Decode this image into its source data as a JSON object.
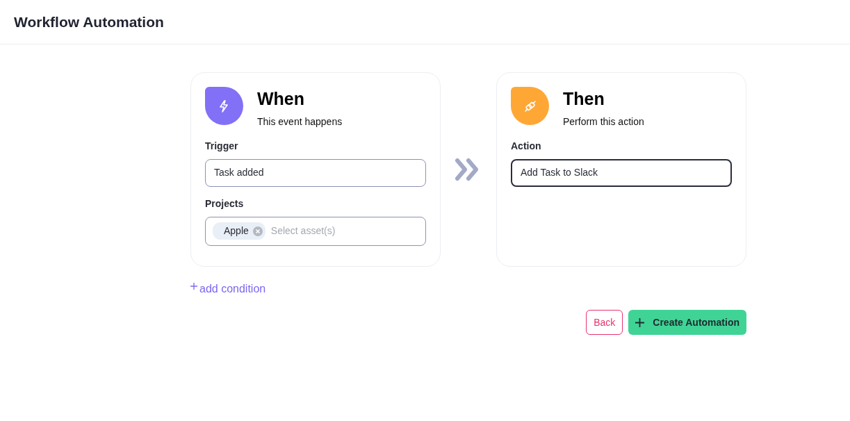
{
  "header": {
    "title": "Workflow Automation"
  },
  "cards": [
    {
      "kind": "trigger",
      "title": "When",
      "subtitle": "This event happens",
      "color": "#8270f6",
      "fields": [
        {
          "kind": "select",
          "label": "Trigger",
          "value": "Task added",
          "focused": false
        },
        {
          "kind": "tags",
          "label": "Projects",
          "tags": [
            "Apple"
          ],
          "placeholder": "Select asset(s)",
          "focused": false
        }
      ]
    },
    {
      "kind": "action",
      "title": "Then",
      "subtitle": "Perform this action",
      "color": "#ffa735",
      "fields": [
        {
          "kind": "select",
          "label": "Action",
          "value": "Add Task to Slack",
          "focused": true
        }
      ]
    }
  ],
  "add_condition": "add condition",
  "buttons": [
    {
      "kind": "back",
      "label": "Back"
    },
    {
      "kind": "create",
      "label": "Create Automation"
    }
  ]
}
